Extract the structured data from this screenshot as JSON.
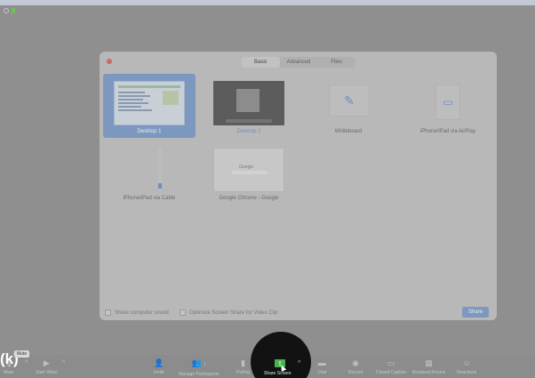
{
  "window": {
    "status_dots": 2
  },
  "dialog": {
    "tabs": [
      {
        "label": "Basic",
        "active": true
      },
      {
        "label": "Advanced",
        "active": false
      },
      {
        "label": "Files",
        "active": false
      }
    ],
    "sources": [
      {
        "label": "Desktop 1",
        "selected": true
      },
      {
        "label": "Desktop 2",
        "selected": false
      },
      {
        "label": "Whiteboard",
        "selected": false
      },
      {
        "label": "iPhone/iPad via AirPlay",
        "selected": false
      },
      {
        "label": "iPhone/iPad via Cable",
        "selected": false
      },
      {
        "label": "Google Chrome - Google",
        "selected": false
      }
    ],
    "chrome_thumb_text": "Google",
    "options": {
      "share_sound": "Share computer sound",
      "optimize_video": "Optimize Screen Share for Video Clip"
    },
    "share_button": "Share"
  },
  "toolbar": {
    "mute_label": "Mute",
    "tooltip": "Mute",
    "start_video_label": "Start Video",
    "invite_label": "Invite",
    "participants_label": "Manage Participants",
    "participants_count": "1",
    "polling_label": "Polling",
    "share_screen_label": "Share Screen",
    "chat_label": "Chat",
    "record_label": "Record",
    "caption_label": "Closed Caption",
    "breakout_label": "Breakout Rooms",
    "reactions_label": "Reactions",
    "keyboard_hint": "(k)"
  },
  "colors": {
    "accent_blue": "#7d98bf",
    "share_green": "#47b34d"
  }
}
